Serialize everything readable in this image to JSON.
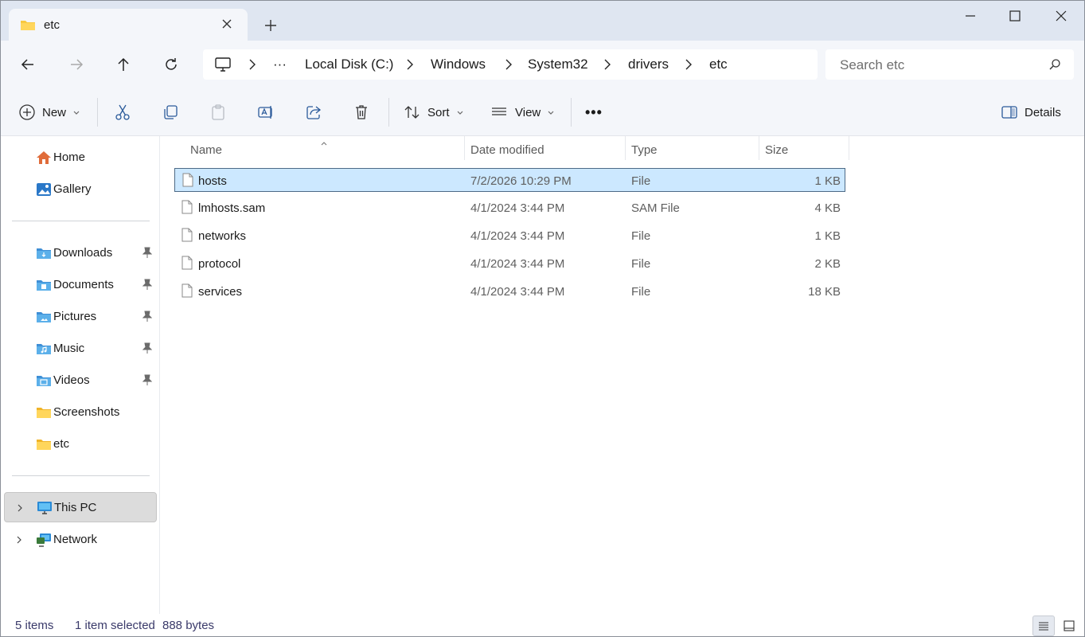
{
  "window": {
    "tab_title": "etc",
    "new_tab_symbol": "+"
  },
  "address": {
    "crumbs": [
      "Local Disk (C:)",
      "Windows",
      "System32",
      "drivers",
      "etc"
    ],
    "ellipsis": "···"
  },
  "search": {
    "placeholder": "Search etc"
  },
  "toolbar": {
    "new_label": "New",
    "sort_label": "Sort",
    "view_label": "View",
    "more_label": "•••",
    "details_label": "Details"
  },
  "sidebar": {
    "quick": [
      {
        "label": "Home",
        "icon": "home-icon"
      },
      {
        "label": "Gallery",
        "icon": "gallery-icon"
      }
    ],
    "pinned": [
      {
        "label": "Downloads",
        "icon": "downloads-folder-icon",
        "pinned": true
      },
      {
        "label": "Documents",
        "icon": "documents-folder-icon",
        "pinned": true
      },
      {
        "label": "Pictures",
        "icon": "pictures-folder-icon",
        "pinned": true
      },
      {
        "label": "Music",
        "icon": "music-folder-icon",
        "pinned": true
      },
      {
        "label": "Videos",
        "icon": "videos-folder-icon",
        "pinned": true
      },
      {
        "label": "Screenshots",
        "icon": "folder-icon",
        "pinned": false
      },
      {
        "label": "etc",
        "icon": "folder-icon",
        "pinned": false
      }
    ],
    "roots": [
      {
        "label": "This PC",
        "icon": "this-pc-icon",
        "selected": true
      },
      {
        "label": "Network",
        "icon": "network-icon",
        "selected": false
      }
    ]
  },
  "columns": {
    "name": "Name",
    "date": "Date modified",
    "type": "Type",
    "size": "Size"
  },
  "files": [
    {
      "name": "hosts",
      "date": "7/2/2026 10:29 PM",
      "type": "File",
      "size": "1 KB",
      "selected": true
    },
    {
      "name": "lmhosts.sam",
      "date": "4/1/2024 3:44 PM",
      "type": "SAM File",
      "size": "4 KB",
      "selected": false
    },
    {
      "name": "networks",
      "date": "4/1/2024 3:44 PM",
      "type": "File",
      "size": "1 KB",
      "selected": false
    },
    {
      "name": "protocol",
      "date": "4/1/2024 3:44 PM",
      "type": "File",
      "size": "2 KB",
      "selected": false
    },
    {
      "name": "services",
      "date": "4/1/2024 3:44 PM",
      "type": "File",
      "size": "18 KB",
      "selected": false
    }
  ],
  "status": {
    "item_count": "5 items",
    "selection": "1 item selected",
    "selection_size": "888 bytes"
  },
  "colors": {
    "selection_bg": "#cce8ff",
    "selection_border": "#4d6a86",
    "folder_yellow": "#f8c840",
    "folder_blue": "#4aa3df",
    "titlebar_bg": "#dfe6f1"
  }
}
